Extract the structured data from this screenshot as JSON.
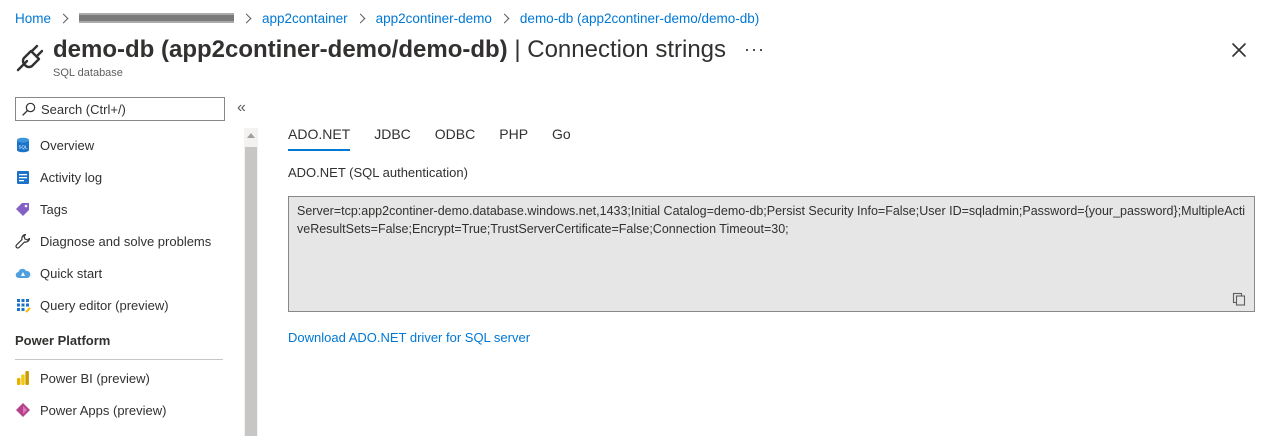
{
  "breadcrumb": {
    "home": "Home",
    "items": [
      "app2container",
      "app2continer-demo",
      "demo-db (app2continer-demo/demo-db)"
    ]
  },
  "header": {
    "title_main": "demo-db (app2continer-demo/demo-db)",
    "title_separator": " | ",
    "title_sub": "Connection strings",
    "more": "···",
    "subtitle": "SQL database"
  },
  "sidebar": {
    "search_placeholder": "Search (Ctrl+/)",
    "collapse": "«",
    "items": [
      {
        "label": "Overview",
        "icon": "sql-database-icon"
      },
      {
        "label": "Activity log",
        "icon": "activity-log-icon"
      },
      {
        "label": "Tags",
        "icon": "tag-icon"
      },
      {
        "label": "Diagnose and solve problems",
        "icon": "wrench-icon"
      },
      {
        "label": "Quick start",
        "icon": "quickstart-cloud-icon"
      },
      {
        "label": "Query editor (preview)",
        "icon": "query-grid-icon"
      }
    ],
    "section_power_platform": "Power Platform",
    "power_items": [
      {
        "label": "Power BI (preview)",
        "icon": "power-bi-icon"
      },
      {
        "label": "Power Apps (preview)",
        "icon": "power-apps-icon"
      }
    ]
  },
  "tabs": [
    "ADO.NET",
    "JDBC",
    "ODBC",
    "PHP",
    "Go"
  ],
  "active_tab": "ADO.NET",
  "content": {
    "auth_label": "ADO.NET (SQL authentication)",
    "connection_string": "Server=tcp:app2continer-demo.database.windows.net,1433;Initial Catalog=demo-db;Persist Security Info=False;User ID=sqladmin;Password={your_password};MultipleActiveResultSets=False;Encrypt=True;TrustServerCertificate=False;Connection Timeout=30;",
    "download_link": "Download ADO.NET driver for SQL server"
  },
  "colors": {
    "accent": "#0078d4",
    "text": "#323130",
    "box_bg": "#e6e6e6"
  }
}
